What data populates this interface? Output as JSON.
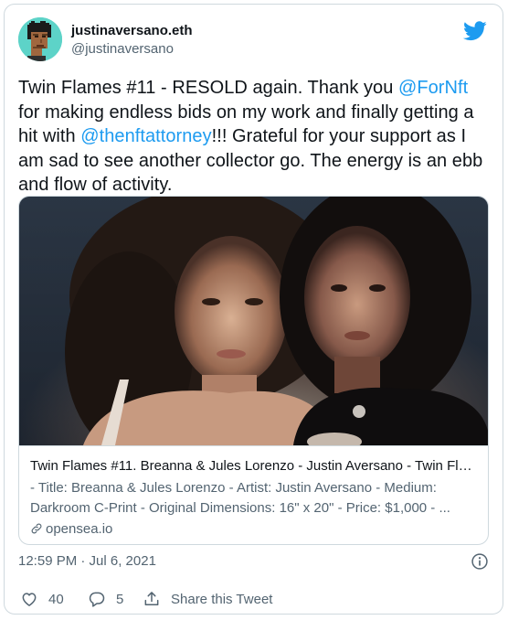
{
  "author": {
    "display_name": "justinaversano.eth",
    "handle": "@justinaversano"
  },
  "icons": {
    "logo": "twitter-bird-icon",
    "avatar": "pixel-punk-avatar",
    "link": "link-icon",
    "info": "info-icon",
    "like": "heart-icon",
    "reply": "reply-bubble-icon",
    "share": "share-upload-icon"
  },
  "colors": {
    "accent": "#1d9bf0",
    "secondary_text": "#536471",
    "border": "#cfd9de",
    "avatar_bg": "#5dd3c8"
  },
  "tweet": {
    "text_part1": "Twin Flames #11 - RESOLD again. Thank you ",
    "mention1": "@ForNft",
    "text_part2": " for making endless bids on my work and finally getting a hit with ",
    "mention2": "@thenftattorney",
    "text_part3": "!!! Grateful for your support as I am sad to see another collector go. The energy is an ebb and flow of activity."
  },
  "link_card": {
    "title": "Twin Flames #11. Breanna & Jules Lorenzo - Justin Aversano - Twin Flam...",
    "description": "- Title: Breanna & Jules Lorenzo - Artist: Justin Aversano - Medium: Darkroom C-Print - Original Dimensions: 16\" x 20\" - Price: $1,000 - ...",
    "domain": "opensea.io"
  },
  "timestamp": "12:59 PM · Jul 6, 2021",
  "stats": {
    "likes": "40",
    "replies": "5",
    "share_label": "Share this Tweet"
  }
}
